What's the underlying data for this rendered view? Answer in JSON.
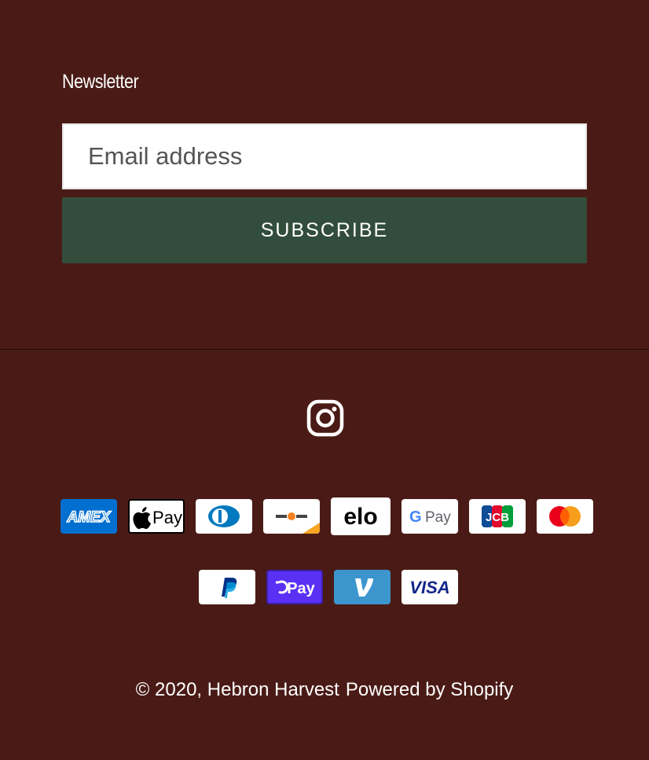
{
  "newsletter": {
    "heading": "Newsletter",
    "email_placeholder": "Email address",
    "subscribe_label": "SUBSCRIBE"
  },
  "social": {
    "icons": [
      "instagram-icon"
    ]
  },
  "payments": {
    "row1": [
      "American Express",
      "Apple Pay",
      "Diners Club",
      "Discover",
      "Elo",
      "Google Pay",
      "JCB",
      "Mastercard"
    ],
    "row2": [
      "PayPal",
      "Shop Pay",
      "Venmo",
      "Visa"
    ],
    "labels": {
      "amex": "AMEX",
      "applepay": "Pay",
      "elo": "elo",
      "gpay": "Pay",
      "jcb": "JCB",
      "shoppay": "Pay",
      "visa": "VISA"
    }
  },
  "footer": {
    "copyright": "© 2020,",
    "store_name": "Hebron Harvest",
    "powered_by": "Powered by Shopify"
  },
  "colors": {
    "background": "#4a1b16",
    "subscribe_button": "#334d3c"
  }
}
